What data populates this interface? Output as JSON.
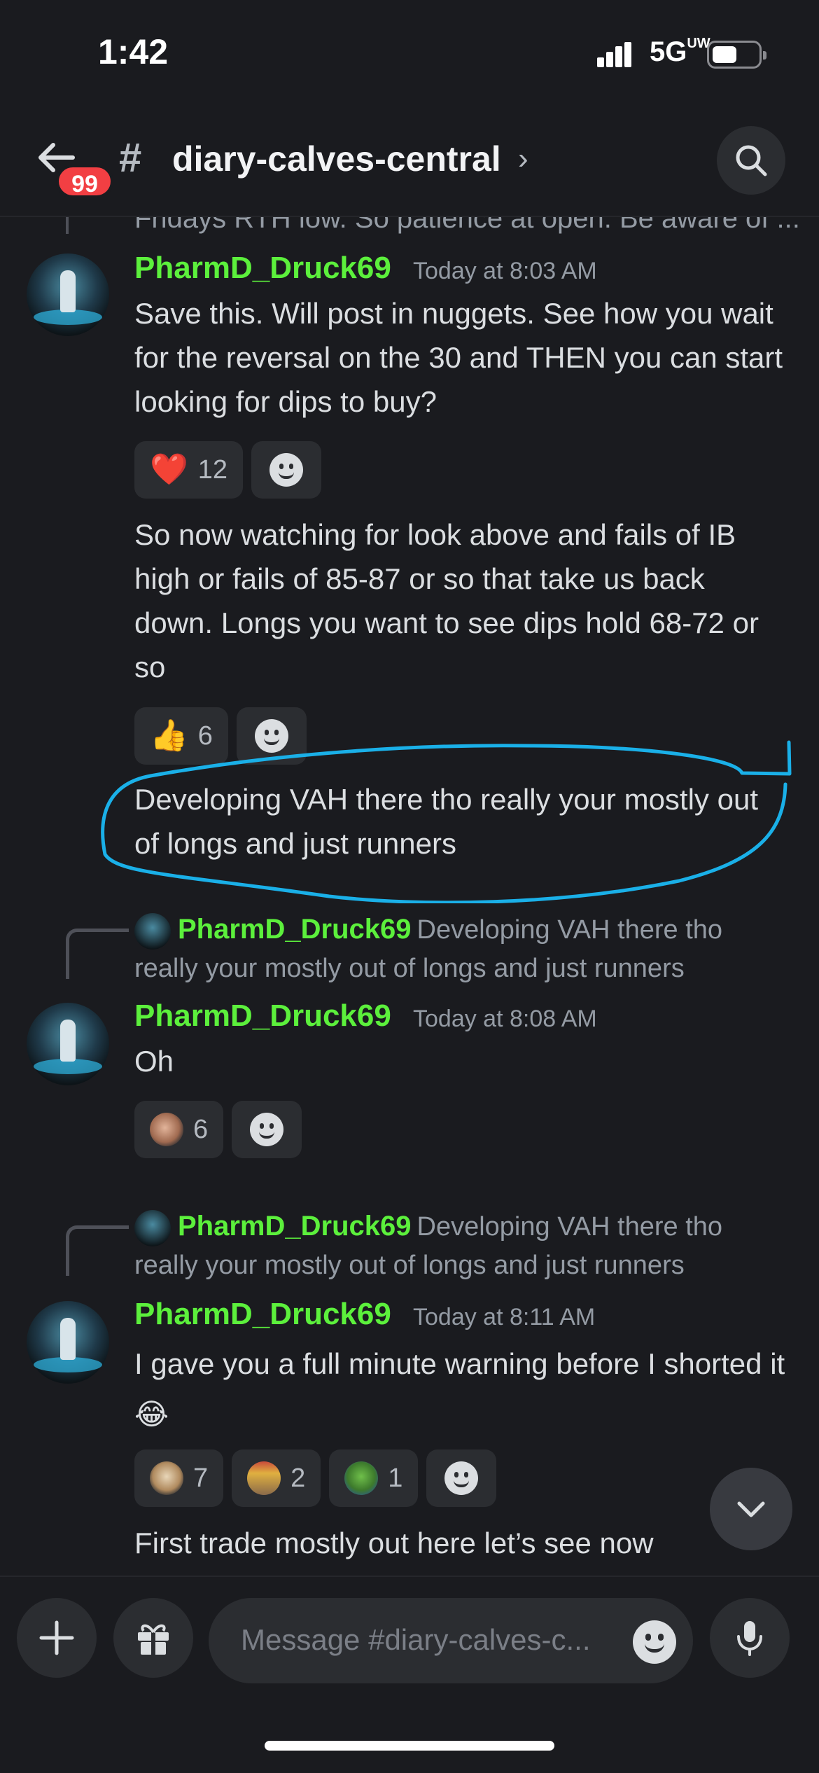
{
  "status": {
    "time": "1:42",
    "network": "5G",
    "network_suffix": "UW"
  },
  "header": {
    "unread_badge": "99",
    "channel_icon": "#",
    "channel_name": "diary-calves-central",
    "chevron": "›"
  },
  "feed": {
    "clipped_text": "Fridays RTH low. So patience at open. Be aware of ...",
    "messages": [
      {
        "author": "PharmD_Druck69",
        "timestamp": "Today at 8:03 AM",
        "text": "Save this. Will post in nuggets. See how you wait for the reversal on the 30 and THEN you can start looking for dips to buy?",
        "reactions": [
          {
            "emoji": "❤️",
            "count": "12"
          }
        ]
      },
      {
        "text": "So now watching for look above and fails of IB high or fails of 85-87 or so that take us back down. Longs you want to see dips hold 68-72 or so",
        "reactions": [
          {
            "emoji": "👍",
            "count": "6"
          }
        ]
      },
      {
        "text": "Developing VAH there tho really your mostly out of longs and just runners",
        "highlight_color": "#1ab0e8"
      },
      {
        "reply_to": {
          "author": "PharmD_Druck69",
          "text": "Developing VAH there tho really your mostly out of longs and just runners"
        },
        "author": "PharmD_Druck69",
        "timestamp": "Today at 8:08 AM",
        "text": "Oh",
        "reactions": [
          {
            "emoji": "face-sticker",
            "count": "6"
          }
        ]
      },
      {
        "reply_to": {
          "author": "PharmD_Druck69",
          "text": "Developing VAH there tho really your mostly out of longs and just runners"
        },
        "author": "PharmD_Druck69",
        "timestamp": "Today at 8:11 AM",
        "text": "I gave you a full minute warning before I shorted it",
        "text_emoji": "😂",
        "reactions": [
          {
            "emoji": "dog-sticker",
            "count": "7"
          },
          {
            "emoji": "king-sticker",
            "count": "2"
          },
          {
            "emoji": "pepe-sticker",
            "count": "1"
          }
        ]
      },
      {
        "text": "First trade mostly out here let’s see now"
      }
    ]
  },
  "composer": {
    "placeholder": "Message #diary-calves-c..."
  },
  "colors": {
    "background": "#1a1b1f",
    "author": "#5cf03c",
    "badge": "#f23f43",
    "highlight": "#1ab0e8"
  }
}
